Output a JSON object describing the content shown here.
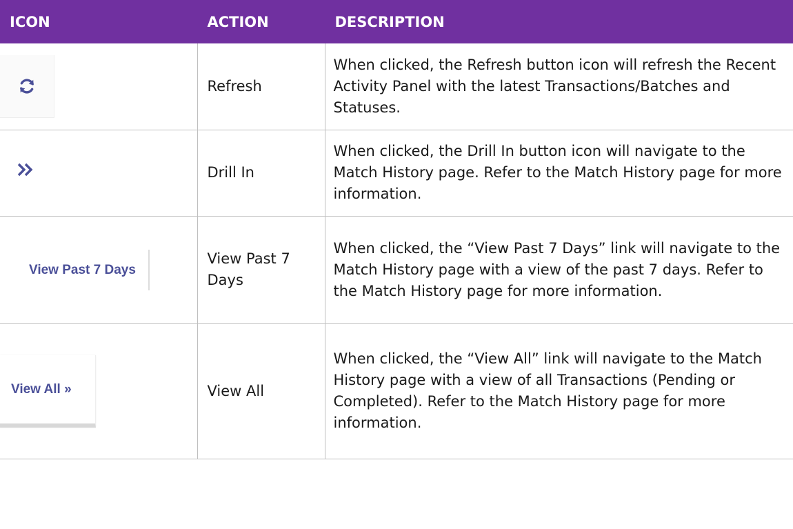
{
  "header": {
    "icon": "ICON",
    "action": "ACTION",
    "description": "DESCRIPTION"
  },
  "colors": {
    "header_bg": "#7030a0",
    "icon_color": "#4a4f98"
  },
  "rows": [
    {
      "icon": "refresh-icon",
      "action": "Refresh",
      "description": "When clicked, the Refresh button icon will refresh the Recent Activity Panel with the latest Transactions/Batches and Statuses."
    },
    {
      "icon": "double-chevron-right-icon",
      "action": "Drill In",
      "description": "When clicked, the Drill In button icon will navigate to the Match History page. Refer to the Match History page for more information."
    },
    {
      "icon_text": "View Past 7 Days",
      "action": "View Past 7 Days",
      "description": "When clicked, the “View Past 7 Days” link will navigate to the Match History page with a view of the past 7 days. Refer to the Match History page for more information."
    },
    {
      "icon_text": "View All »",
      "action": "View All",
      "description": "When clicked, the “View All” link will navigate to the Match History page with a view of all Transactions (Pending or Completed). Refer to the Match History page for more information."
    }
  ]
}
